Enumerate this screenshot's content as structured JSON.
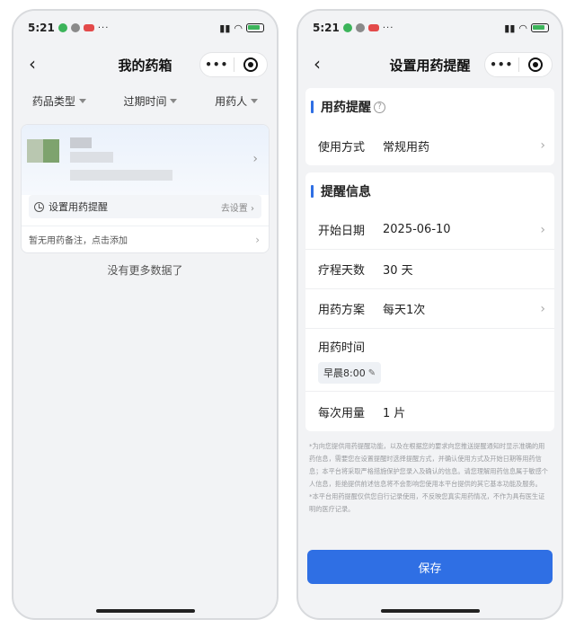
{
  "left": {
    "status": {
      "time": "5:21",
      "more": "···"
    },
    "nav": {
      "title": "我的药箱",
      "capsule_more": "•••"
    },
    "filters": [
      "药品类型",
      "过期时间",
      "用药人"
    ],
    "card": {
      "reminder_label": "设置用药提醒",
      "reminder_action": "去设置 ›",
      "note": "暂无用药备注，点击添加"
    },
    "empty_text": "没有更多数据了"
  },
  "right": {
    "status": {
      "time": "5:21",
      "more": "···"
    },
    "nav": {
      "title": "设置用药提醒",
      "capsule_more": "•••"
    },
    "section1": {
      "title": "用药提醒",
      "usage_label": "使用方式",
      "usage_value": "常规用药"
    },
    "section2": {
      "title": "提醒信息",
      "start_label": "开始日期",
      "start_value": "2025-06-10",
      "days_label": "疗程天数",
      "days_value": "30 天",
      "plan_label": "用药方案",
      "plan_value": "每天1次",
      "time_label": "用药时间",
      "time_chip": "早晨8:00",
      "dose_label": "每次用量",
      "dose_value": "1 片"
    },
    "disclaimer_1": "*为向您提供用药提醒功能，以及在根据您的要求向您推送提醒通知时显示准确的用药信息，需要您在设置提醒时选择提醒方式，并确认使用方式及开始日期等用药信息；本平台将采取严格措施保护您录入及确认的信息。请您理解用药信息属于敏感个人信息，拒绝提供前述信息将不会影响您使用本平台提供的其它基本功能及服务。",
    "disclaimer_2": "*本平台用药提醒仅供您自行记录使用，不反映您真实用药情况，不作为具有医生证明的医疗记录。",
    "save_label": "保存"
  },
  "colors": {
    "accent": "#2f6fe4",
    "background": "#f2f3f5"
  }
}
